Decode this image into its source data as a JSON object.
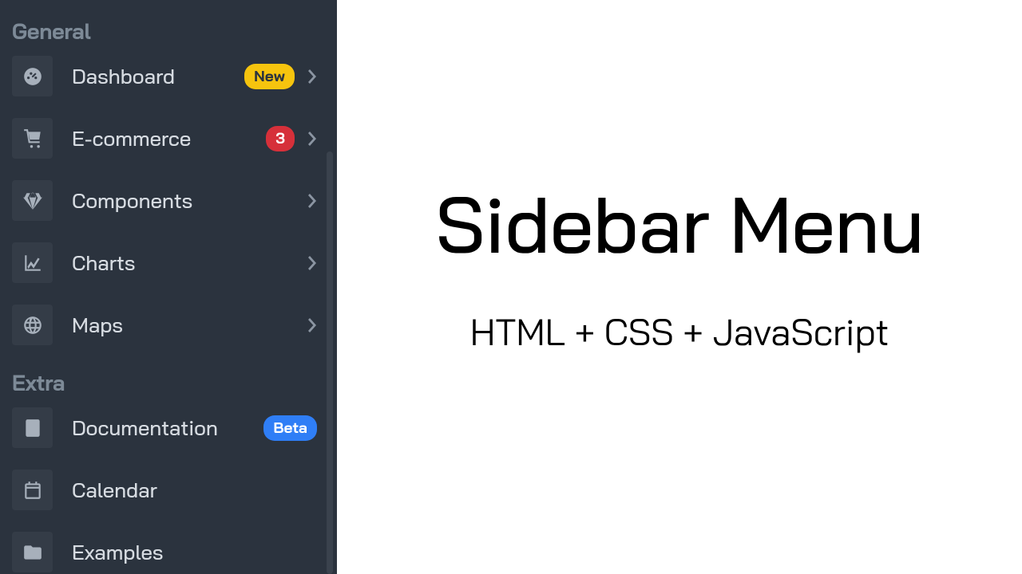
{
  "sidebar": {
    "sections": {
      "general": {
        "header": "General",
        "items": [
          {
            "label": "Dashboard",
            "badge": "New",
            "badge_color": "yellow",
            "chevron": true
          },
          {
            "label": "E-commerce",
            "badge": "3",
            "badge_color": "red",
            "chevron": true
          },
          {
            "label": "Components",
            "chevron": true
          },
          {
            "label": "Charts",
            "chevron": true
          },
          {
            "label": "Maps",
            "chevron": true
          }
        ]
      },
      "extra": {
        "header": "Extra",
        "items": [
          {
            "label": "Documentation",
            "badge": "Beta",
            "badge_color": "blue",
            "chevron": false
          },
          {
            "label": "Calendar",
            "chevron": false
          },
          {
            "label": "Examples",
            "chevron": false
          }
        ]
      }
    }
  },
  "main": {
    "title": "Sidebar Menu",
    "subtitle": "HTML + CSS + JavaScript"
  }
}
